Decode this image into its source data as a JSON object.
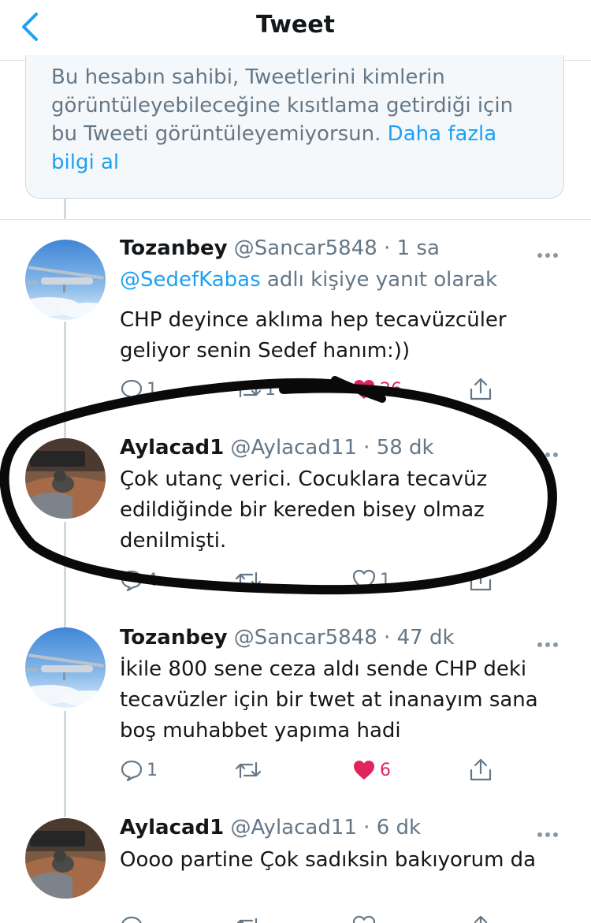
{
  "header": {
    "title": "Tweet"
  },
  "notice": {
    "text": "Bu hesabın sahibi, Tweetlerini kimlerin görüntüleyebileceğine kısıtlama getirdiği için bu Tweeti görüntüleyemiyorsun.",
    "link": "Daha fazla bilgi al"
  },
  "tweets": [
    {
      "name": "Tozanbey",
      "meta": "@Sancar5848 · 1 sa",
      "reply_mention": "@SedefKabas",
      "reply_suffix": " adlı kişiye yanıt olarak",
      "text": "CHP deyince aklıma hep tecavüzcüler geliyor senin Sedef hanım:))",
      "replies": "1",
      "retweets": "1",
      "likes": "26"
    },
    {
      "name": "Aylacad1",
      "meta": "@Aylacad11 · 58 dk",
      "text": "Çok utanç  verici. Cocuklara  tecavüz edildiğinde  bir kereden bisey olmaz denilmişti.",
      "replies": "4",
      "retweets": "",
      "likes": "1"
    },
    {
      "name": "Tozanbey",
      "meta": "@Sancar5848 · 47 dk",
      "text": "İkile 800 sene ceza aldı  sende CHP deki tecavüzler için bir twet at inanayım sana boş muhabbet yapıma hadi",
      "replies": "1",
      "retweets": "",
      "likes": "6"
    },
    {
      "name": "Aylacad1",
      "meta": "@Aylacad11 · 6 dk",
      "text": "Oooo partine  Çok sadıksin  bakıyorum da"
    }
  ],
  "colors": {
    "accent": "#1da1f2",
    "like": "#e0245e",
    "muted": "#657786"
  }
}
